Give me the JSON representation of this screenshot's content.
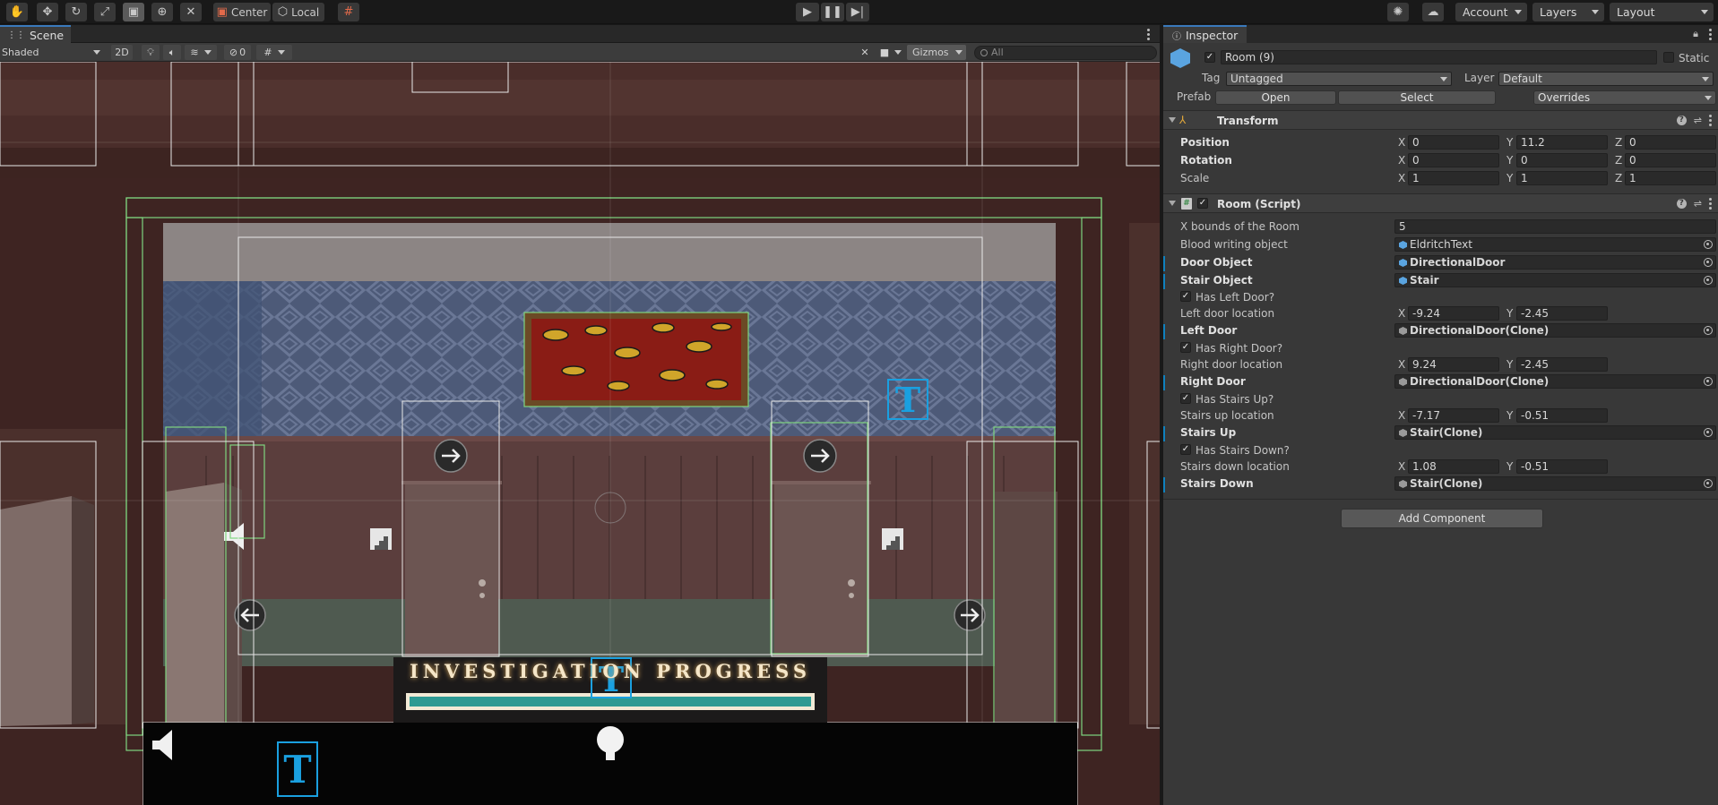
{
  "toolbar": {
    "pivot_label": "Center",
    "space_label": "Local",
    "account_label": "Account",
    "layers_label": "Layers",
    "layout_label": "Layout"
  },
  "scene": {
    "tab_label": "Scene",
    "shading_mode": "Shaded",
    "mode_2d_label": "2D",
    "hidden_count": "0",
    "gizmos_label": "Gizmos",
    "search_placeholder": "All"
  },
  "game_ui": {
    "progress_title": "INVESTIGATION PROGRESS"
  },
  "inspector": {
    "tab_label": "Inspector",
    "object_name": "Room (9)",
    "static_label": "Static",
    "tag_label": "Tag",
    "tag_value": "Untagged",
    "layer_label": "Layer",
    "layer_value": "Default",
    "prefab_label": "Prefab",
    "prefab_open": "Open",
    "prefab_select": "Select",
    "prefab_overrides": "Overrides",
    "transform": {
      "title": "Transform",
      "position_label": "Position",
      "rotation_label": "Rotation",
      "scale_label": "Scale",
      "position": {
        "x": "0",
        "y": "11.2",
        "z": "0"
      },
      "rotation": {
        "x": "0",
        "y": "0",
        "z": "0"
      },
      "scale": {
        "x": "1",
        "y": "1",
        "z": "1"
      }
    },
    "room_script": {
      "title": "Room (Script)",
      "x_bounds_label": "X bounds of the Room",
      "x_bounds_value": "5",
      "blood_label": "Blood writing object",
      "blood_value": "EldritchText",
      "door_object_label": "Door Object",
      "door_object_value": "DirectionalDoor",
      "stair_object_label": "Stair Object",
      "stair_object_value": "Stair",
      "has_left_door_label": "Has Left Door?",
      "left_door_location_label": "Left door location",
      "left_door_location": {
        "x": "-9.24",
        "y": "-2.45"
      },
      "left_door_label": "Left Door",
      "left_door_value": "DirectionalDoor(Clone)",
      "has_right_door_label": "Has Right Door?",
      "right_door_location_label": "Right door location",
      "right_door_location": {
        "x": "9.24",
        "y": "-2.45"
      },
      "right_door_label": "Right Door",
      "right_door_value": "DirectionalDoor(Clone)",
      "has_stairs_up_label": "Has Stairs Up?",
      "stairs_up_location_label": "Stairs up location",
      "stairs_up_location": {
        "x": "-7.17",
        "y": "-0.51"
      },
      "stairs_up_label": "Stairs Up",
      "stairs_up_value": "Stair(Clone)",
      "has_stairs_down_label": "Has Stairs Down?",
      "stairs_down_location_label": "Stairs down location",
      "stairs_down_location": {
        "x": "1.08",
        "y": "-0.51"
      },
      "stairs_down_label": "Stairs Down",
      "stairs_down_value": "Stair(Clone)"
    },
    "add_component_label": "Add Component",
    "axis": {
      "x": "X",
      "y": "Y",
      "z": "Z"
    },
    "check_glyph": "✓"
  }
}
